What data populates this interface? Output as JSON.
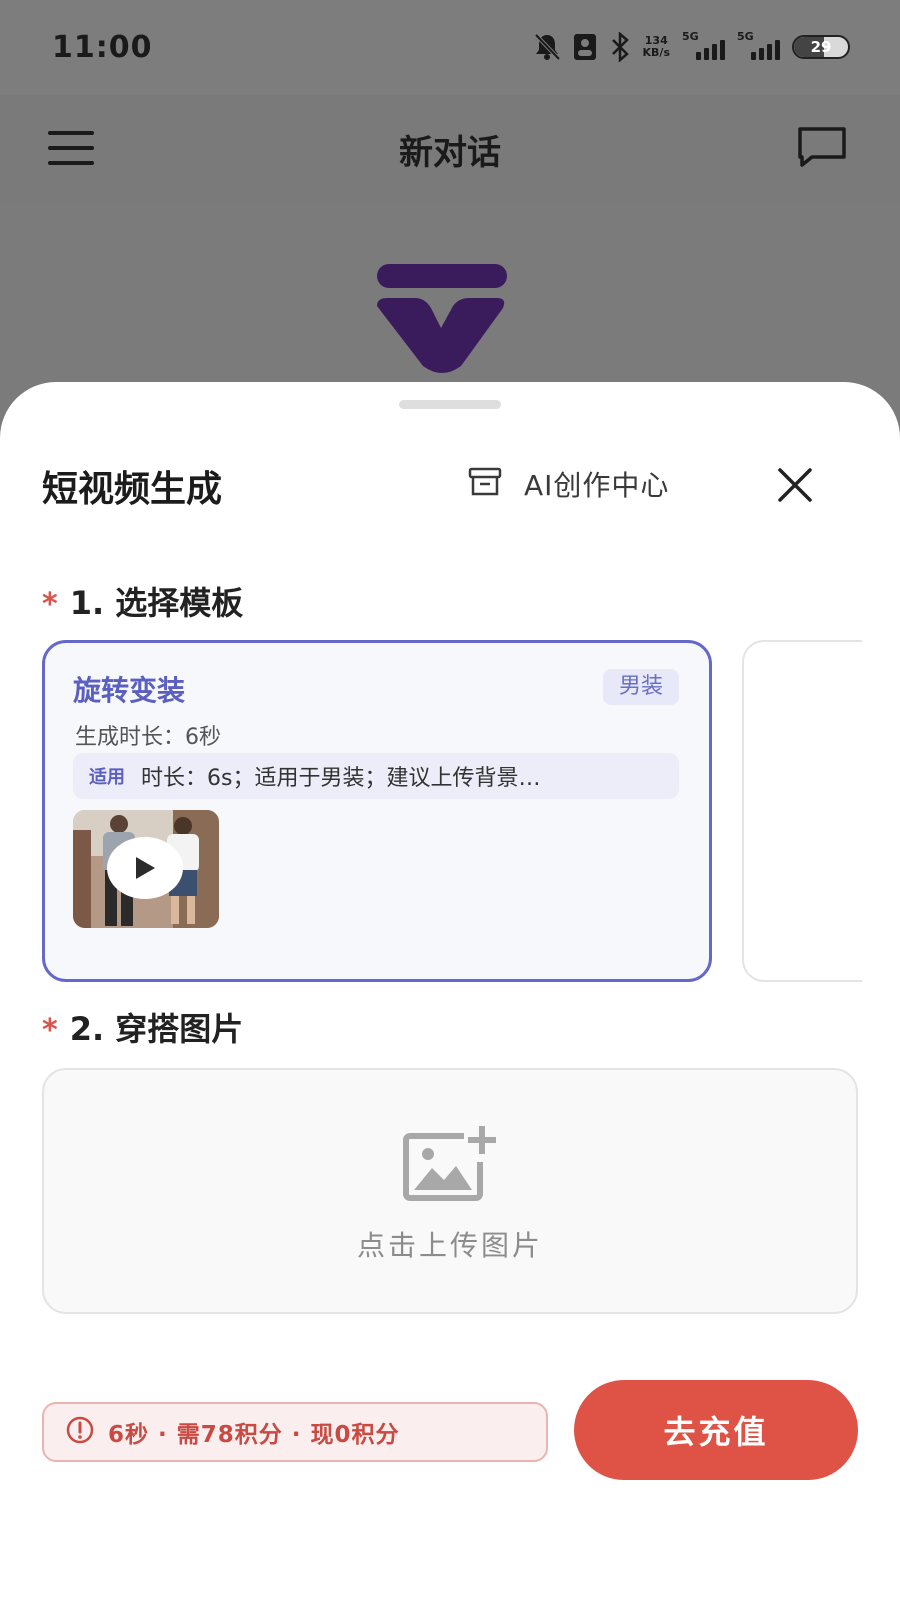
{
  "status_bar": {
    "time": "11:00",
    "net_speed": "134",
    "net_unit": "KB/s",
    "sim1": "5G",
    "sim2": "5G",
    "battery": "29"
  },
  "app_bar": {
    "title": "新对话",
    "icons": [
      "menu-icon",
      "new-chat-icon"
    ]
  },
  "sheet": {
    "title": "短视频生成",
    "creation_center_label": "AI创作中心",
    "section1": {
      "required_mark": "*",
      "title": "1. 选择模板"
    },
    "template": {
      "name": "旋转变装",
      "tag": "男装",
      "duration": "生成时长：6秒",
      "usage_badge": "适用",
      "usage_desc": "时长：6s；适用于男装；建议上传背景…"
    },
    "section2": {
      "required_mark": "*",
      "title": "2. 穿搭图片"
    },
    "upload": {
      "label": "点击上传图片"
    },
    "footer": {
      "cost_text": "6秒 · 需78积分 · 现0积分",
      "recharge_label": "去充值"
    }
  },
  "colors": {
    "accent_purple": "#6468c8",
    "recharge_red": "#df5246",
    "logo_purple": "#3a1b5c"
  }
}
